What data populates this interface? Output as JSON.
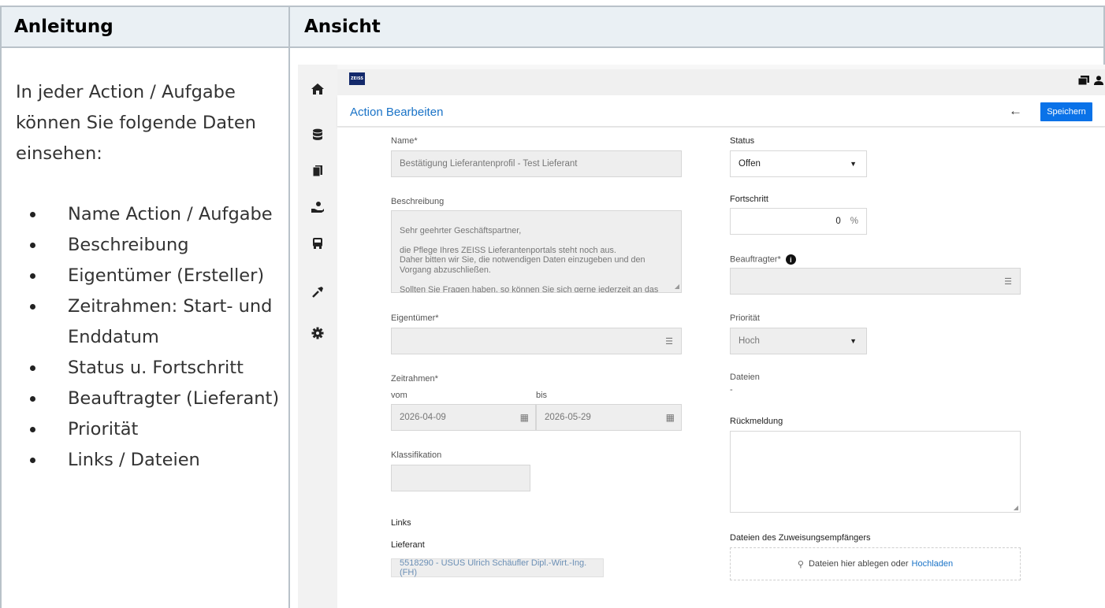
{
  "table": {
    "col1_header": "Anleitung",
    "col2_header": "Ansicht"
  },
  "instructions": {
    "intro": "In jeder Action / Aufgabe können Sie folgende Daten einsehen:",
    "items": [
      "Name Action / Aufgabe",
      "Beschreibung",
      "Eigentümer (Ersteller)",
      "Zeitrahmen: Start- und Enddatum",
      "Status u. Fortschritt",
      "Beauftragter (Lieferant)",
      "Priorität",
      "Links / Dateien"
    ]
  },
  "app": {
    "brand_logo_text": "ZEISS",
    "rail_icons": [
      "home-icon",
      "database-icon",
      "documents-icon",
      "hand-user-icon",
      "truck-icon",
      "tools-icon",
      "gear-icon"
    ],
    "page_title": "Action Bearbeiten",
    "back_symbol": "←",
    "save_label": "Speichern",
    "form": {
      "name_label": "Name*",
      "name_value": "Bestätigung Lieferantenprofil - Test Lieferant",
      "description_label": "Beschreibung",
      "description_value": "Sehr geehrter Geschäftspartner,\n\ndie Pflege Ihres ZEISS Lieferantenportals steht noch aus.\nDaher bitten wir Sie, die notwendigen Daten einzugeben und den Vorgang abzuschließen.\n\nSollten Sie Fragen haben, so können Sie sich gerne jederzeit an das Team XYZ wenden.",
      "owner_label": "Eigentümer*",
      "owner_value": "",
      "timeframe_label": "Zeitrahmen*",
      "from_label": "vom",
      "to_label": "bis",
      "from_value": "2026-04-09",
      "to_value": "2026-05-29",
      "classification_label": "Klassifikation",
      "classification_value": "",
      "links_label": "Links",
      "supplier_label": "Lieferant",
      "supplier_value": "5518290 - USUS Ulrich Schäufler Dipl.-Wirt.-Ing.(FH)",
      "status_label": "Status",
      "status_value": "Offen",
      "progress_label": "Fortschritt",
      "progress_value": "0",
      "progress_unit": "%",
      "assignee_label": "Beauftragter*",
      "assignee_value": "",
      "priority_label": "Priorität",
      "priority_value": "Hoch",
      "files_label": "Dateien",
      "files_value": "-",
      "feedback_label": "Rückmeldung",
      "feedback_value": "",
      "assignee_files_label": "Dateien des Zuweisungsempfängers",
      "dropzone_text": "Dateien hier ablegen oder",
      "upload_link": "Hochladen"
    }
  }
}
